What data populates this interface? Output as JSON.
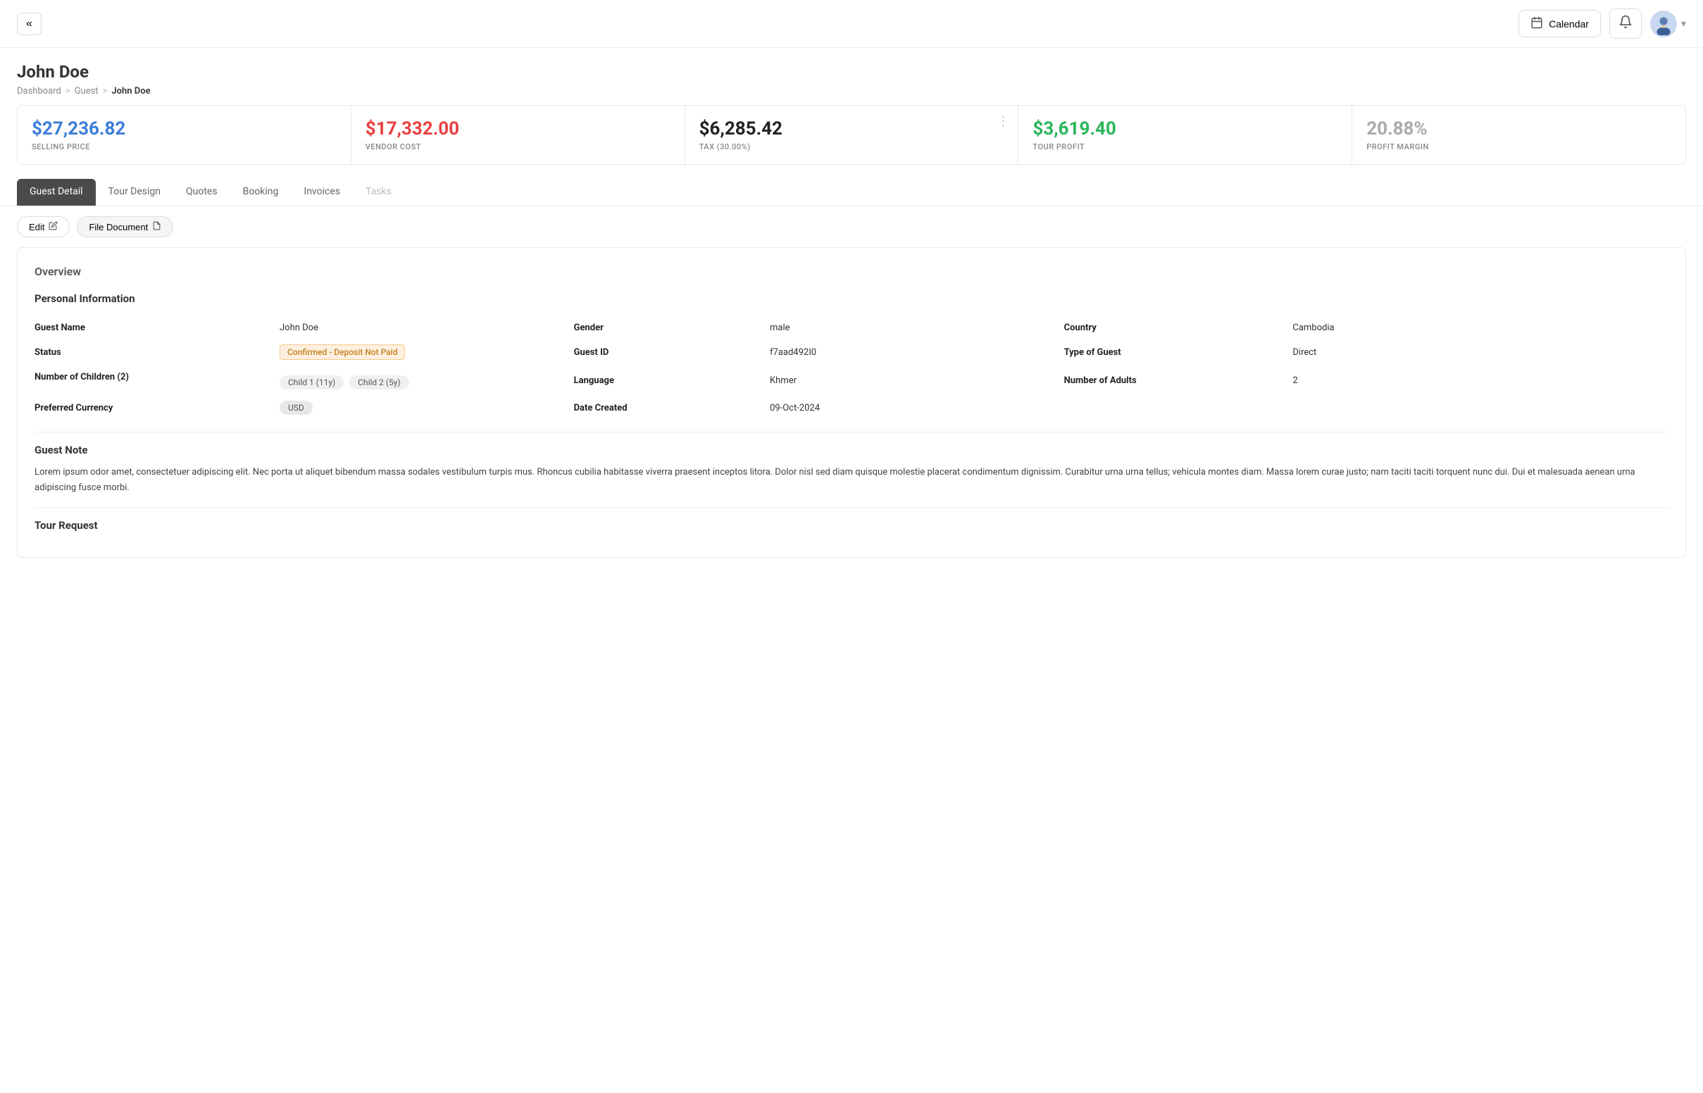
{
  "header": {
    "back_label": "«",
    "calendar_label": "Calendar",
    "bell_label": "🔔",
    "avatar_alt": "User Avatar",
    "chevron_down": "▾"
  },
  "page": {
    "title": "John Doe",
    "breadcrumb": {
      "home": "Dashboard",
      "sep1": ">",
      "parent": "Guest",
      "sep2": ">",
      "current": "John Doe"
    }
  },
  "stats": [
    {
      "value": "$27,236.82",
      "label": "SELLING PRICE",
      "color_class": "stat-blue"
    },
    {
      "value": "$17,332.00",
      "label": "VENDOR COST",
      "color_class": "stat-red"
    },
    {
      "value": "$6,285.42",
      "label": "TAX (30.00%)",
      "color_class": "stat-black",
      "has_menu": true
    },
    {
      "value": "$3,619.40",
      "label": "TOUR PROFIT",
      "color_class": "stat-green"
    },
    {
      "value": "20.88%",
      "label": "PROFIT MARGIN",
      "color_class": "stat-gray"
    }
  ],
  "tabs": [
    {
      "label": "Guest Detail",
      "active": true
    },
    {
      "label": "Tour Design",
      "active": false
    },
    {
      "label": "Quotes",
      "active": false
    },
    {
      "label": "Booking",
      "active": false
    },
    {
      "label": "Invoices",
      "active": false
    },
    {
      "label": "Tasks",
      "active": false
    }
  ],
  "actions": {
    "edit": "Edit",
    "file_document": "File Document"
  },
  "overview": {
    "section_title": "Overview",
    "personal_info": {
      "title": "Personal Information",
      "fields": [
        {
          "label": "Guest Name",
          "value": "John Doe"
        },
        {
          "label": "Gender",
          "value": "male"
        },
        {
          "label": "Country",
          "value": "Cambodia"
        },
        {
          "label": "Status",
          "value": "Confirmed - Deposit Not Paid",
          "type": "badge"
        },
        {
          "label": "Guest ID",
          "value": "f7aad492I0"
        },
        {
          "label": "Type of Guest",
          "value": "Direct"
        },
        {
          "label": "Number of Children (2)",
          "value": "",
          "type": "children"
        },
        {
          "label": "Language",
          "value": "Khmer"
        },
        {
          "label": "Number of Adults",
          "value": "2"
        }
      ],
      "children": [
        {
          "label": "Child 1 (11y)"
        },
        {
          "label": "Child 2 (5y)"
        }
      ],
      "preferred_currency_label": "Preferred Currency",
      "preferred_currency_value": "USD",
      "date_created_label": "Date Created",
      "date_created_value": "09-Oct-2024"
    },
    "guest_note": {
      "title": "Guest Note",
      "text": "Lorem ipsum odor amet, consectetuer adipiscing elit. Nec porta ut aliquet bibendum massa sodales vestibulum turpis mus. Rhoncus cubilia habitasse viverra praesent inceptos litora. Dolor nisl sed diam quisque molestie placerat condimentum dignissim. Curabitur urna urna tellus; vehicula montes diam. Massa lorem curae justo; nam taciti taciti torquent nunc dui. Dui et malesuada aenean urna adipiscing fusce morbi."
    },
    "tour_request": {
      "title": "Tour Request"
    }
  }
}
